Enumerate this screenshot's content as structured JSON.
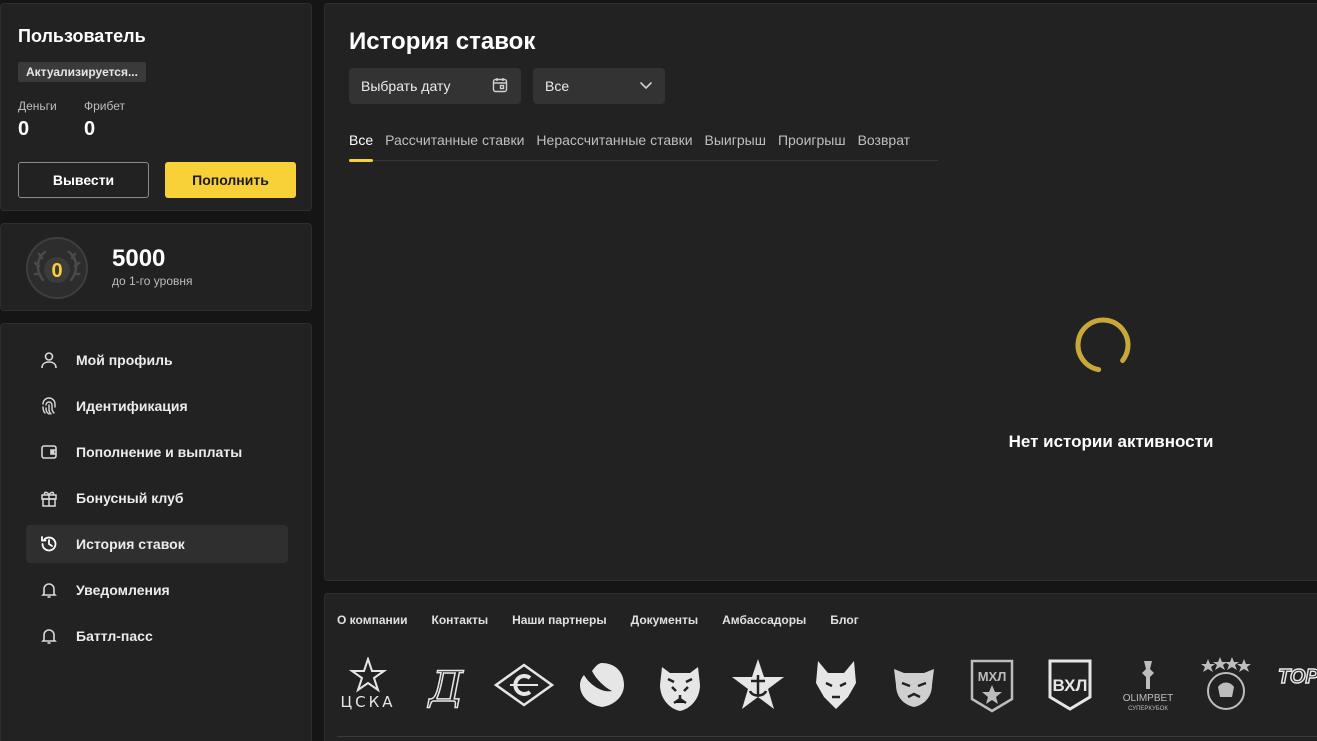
{
  "user": {
    "title": "Пользователь",
    "status": "Актуализируется...",
    "money_label": "Деньги",
    "money_value": "0",
    "freebet_label": "Фрибет",
    "freebet_value": "0",
    "withdraw_label": "Вывести",
    "deposit_label": "Пополнить"
  },
  "level": {
    "badge_value": "0",
    "points": "5000",
    "caption": "до 1-го уровня"
  },
  "menu": {
    "items": [
      {
        "label": "Мой профиль",
        "icon": "user-icon"
      },
      {
        "label": "Идентификация",
        "icon": "fingerprint-icon"
      },
      {
        "label": "Пополнение и выплаты",
        "icon": "wallet-icon"
      },
      {
        "label": "Бонусный клуб",
        "icon": "gift-icon"
      },
      {
        "label": "История ставок",
        "icon": "history-icon",
        "active": true
      },
      {
        "label": "Уведомления",
        "icon": "bell-icon"
      },
      {
        "label": "Баттл-пасс",
        "icon": "bell-icon"
      }
    ]
  },
  "main": {
    "title": "История ставок",
    "date_button": "Выбрать дату",
    "filter_value": "Все",
    "tabs": [
      "Все",
      "Рассчитанные ставки",
      "Нерассчитанные ставки",
      "Выигрыш",
      "Проигрыш",
      "Возврат"
    ],
    "empty_text": "Нет истории активности"
  },
  "footer": {
    "links": [
      "О компании",
      "Контакты",
      "Наши партнеры",
      "Документы",
      "Амбассадоры",
      "Блог"
    ],
    "logos": {
      "cska_text": "ЦСКА",
      "mhl_text": "МХЛ",
      "vhl_text": "ВХЛ",
      "olimpbet_text": "OLIMPBET",
      "olimpbet_sub": "СУПЕРКУБОК",
      "tdd_text": "TOP DOG"
    }
  },
  "colors": {
    "accent": "#f7d137",
    "panel": "#222222",
    "background": "#151515"
  }
}
